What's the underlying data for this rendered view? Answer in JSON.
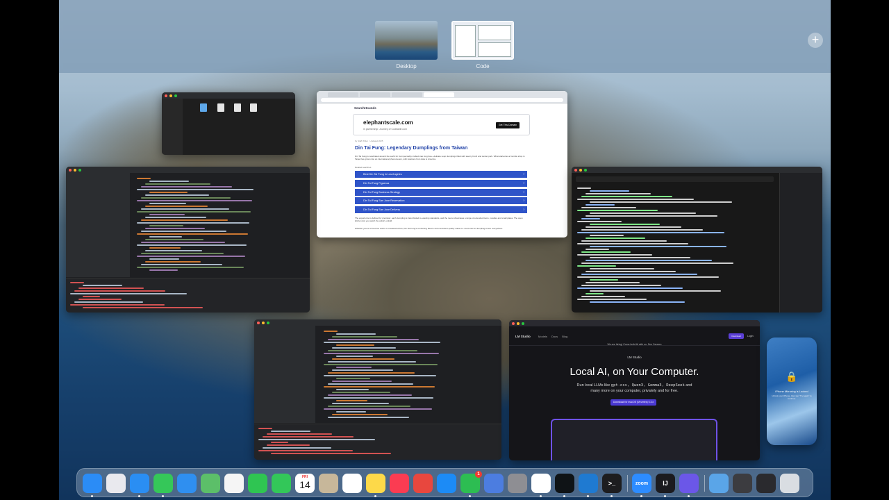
{
  "spaces": {
    "items": [
      {
        "label": "Desktop"
      },
      {
        "label": "Code"
      }
    ],
    "add_label": "+"
  },
  "browser": {
    "site_brand": "SearchHounds",
    "ad": {
      "domain": "elephantscale.com",
      "subtitle": "in partnership: Journey of Codeable.com",
      "button": "Get This Domain"
    },
    "byline": "by Staff Writer  ·  Updated 2025",
    "headline": "Din Tai Fung: Legendary Dumplings from Taiwan",
    "intro": "Din Tai Fung is celebrated around the world for its impeccably crafted xiao long bao—delicate soup dumplings filled with savory broth and tender pork. What started as a humble shop in Taipei has grown into an international phenomenon, with locations from Asia to America.",
    "related_label": "Related searches",
    "links": [
      "Best Din Tai Fung in Los Angeles",
      "Din Tai Fung Figueroa",
      "Din Tai Fung Business Strategy",
      "Din Tai Fung San Jose Reservation",
      "Din Tai Fung San Jose Delivery"
    ],
    "body1": "The experience is defined by precision: each dumpling is hand-folded to exacting standards, and the menu showcases a range of extended items, noodles and small plates. The open kitchen lets you watch the artistry unfold.",
    "body2": "Whether you're a first-time visitor or a seasoned fan, Din Tai Fung's comforting flavors and consistent quality make it a must-visit for dumpling lovers everywhere."
  },
  "lmstudio": {
    "logo": "LM Studio",
    "nav": "Models Docs Blog",
    "download_btn": "Download",
    "login": "Login",
    "banner": "We are hiring! Come build AI with us. See Careers",
    "brand": "LM Studio",
    "hero": "Local AI, on Your Computer.",
    "subtitle_lead": "Run local LLMs like",
    "model_tags": "gpt-oss, Qwen3, Gemma3, DeepSeek",
    "subtitle_tail": "and",
    "subtitle2": "many more on your computer, privately and for free.",
    "cta": "Download for macOS (M series)  0.3.x"
  },
  "iphone": {
    "lock_icon": "🔒",
    "title": "iPhone Mirroring is Locked",
    "subtitle": "Unlock your iPhone, then tap \"Try Again\" to continue."
  },
  "dock": {
    "apps": [
      {
        "name": "Finder",
        "icon": "finder-icon",
        "color": "#2b8cf6"
      },
      {
        "name": "Launchpad",
        "icon": "launchpad-icon",
        "color": "#e9e9ee"
      },
      {
        "name": "Safari",
        "icon": "safari-icon",
        "color": "#2a8ef3"
      },
      {
        "name": "Messages",
        "icon": "messages-icon",
        "color": "#35c759"
      },
      {
        "name": "Mail",
        "icon": "mail-icon",
        "color": "#2f8ff0"
      },
      {
        "name": "Maps",
        "icon": "maps-icon",
        "color": "#5cbf69"
      },
      {
        "name": "Photos",
        "icon": "photos-icon",
        "color": "#f5f5f5"
      },
      {
        "name": "FaceTime",
        "icon": "facetime-icon",
        "color": "#2fc552"
      },
      {
        "name": "Phone",
        "icon": "phone-icon",
        "color": "#33c759"
      },
      {
        "name": "Calendar",
        "icon": "calendar-icon",
        "color": "#ffffff"
      },
      {
        "name": "Contacts",
        "icon": "contacts-icon",
        "color": "#c7b79a"
      },
      {
        "name": "Reminders",
        "icon": "reminders-icon",
        "color": "#ffffff"
      },
      {
        "name": "Notes",
        "icon": "notes-icon",
        "color": "#fdd949"
      },
      {
        "name": "Music",
        "icon": "music-icon",
        "color": "#fb3c52"
      },
      {
        "name": "Rocket",
        "icon": "rocket-icon",
        "color": "#e8473e"
      },
      {
        "name": "App Store",
        "icon": "appstore-icon",
        "color": "#1c8bf6"
      },
      {
        "name": "WhatsApp",
        "icon": "whatsapp-icon",
        "color": "#2dbd52"
      },
      {
        "name": "iPhone Mirroring",
        "icon": "iphone-mirroring-icon",
        "color": "#4c7de0"
      },
      {
        "name": "System Settings",
        "icon": "settings-icon",
        "color": "#8e8e93"
      },
      {
        "name": "Chrome",
        "icon": "chrome-icon",
        "color": "#ffffff"
      },
      {
        "name": "Warp",
        "icon": "warp-icon",
        "color": "#0f1316"
      },
      {
        "name": "VS Code",
        "icon": "vscode-icon",
        "color": "#1f7ad1"
      },
      {
        "name": "Terminal",
        "icon": "terminal-icon",
        "color": "#1d1d1f"
      },
      {
        "name": "Zoom",
        "icon": "zoom-icon",
        "color": "#2d8cff"
      },
      {
        "name": "IntelliJ IDEA",
        "icon": "intellij-icon",
        "color": "#1b1b1f"
      },
      {
        "name": "LM Studio",
        "icon": "lmstudio-icon",
        "color": "#6b57e8"
      },
      {
        "name": "Downloads",
        "icon": "folder-icon",
        "color": "#5aa5e8"
      },
      {
        "name": "Recent",
        "icon": "stack-icon",
        "color": "#3c3c40"
      },
      {
        "name": "Screenshot",
        "icon": "screenshot-icon",
        "color": "#2a2a2e"
      },
      {
        "name": "Trash",
        "icon": "trash-icon",
        "color": "#d9dde2"
      }
    ],
    "calendar": {
      "day": "FRI",
      "date": "14"
    },
    "whatsapp_badge": "1",
    "terminal_glyph": ">_",
    "zoom_label": "zoom",
    "intellij_label": "IJ"
  }
}
